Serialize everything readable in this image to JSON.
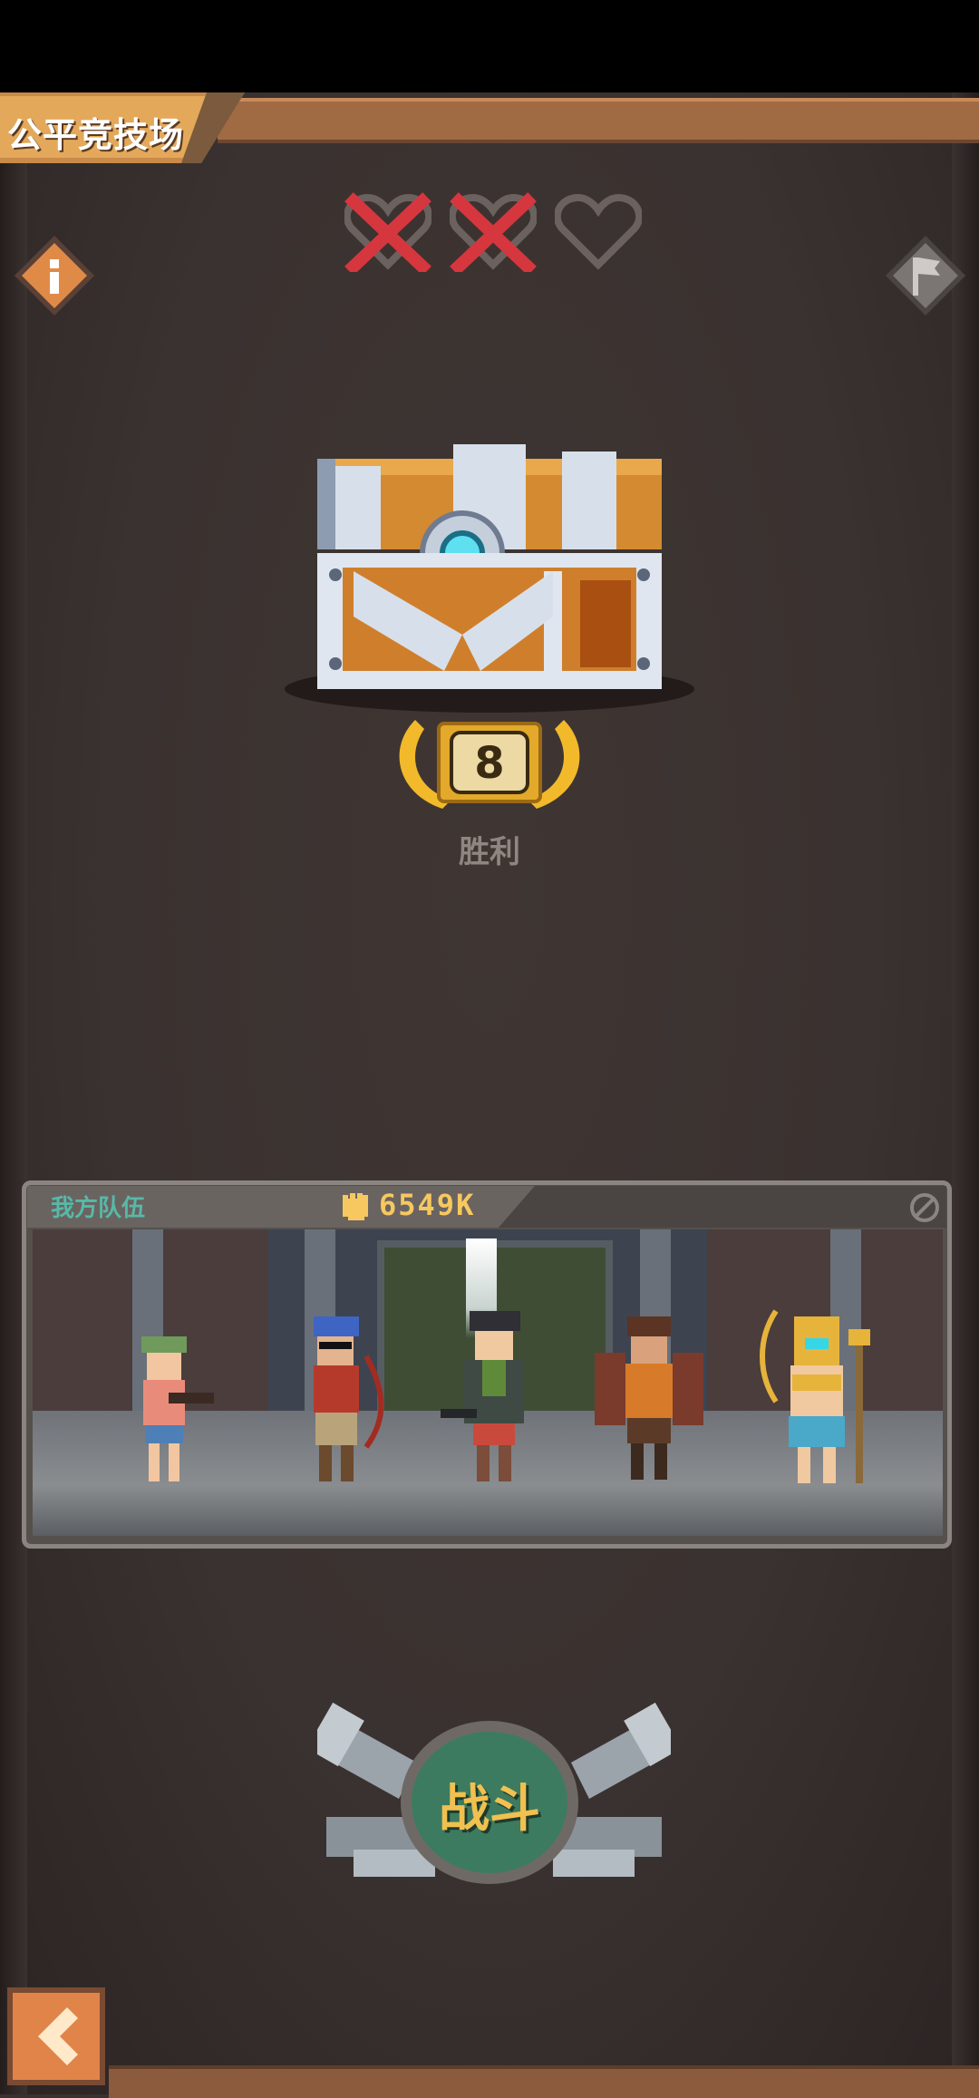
{
  "header": {
    "title": "公平竞技场"
  },
  "lives": {
    "hearts": [
      {
        "state": "lost",
        "icon": "crossed-heart-icon"
      },
      {
        "state": "lost",
        "icon": "crossed-heart-icon"
      },
      {
        "state": "remaining",
        "icon": "heart-outline-icon"
      }
    ]
  },
  "reward": {
    "wins_count": "8",
    "wins_label": "胜利"
  },
  "team": {
    "label": "我方队伍",
    "power": "6549K",
    "heroes": [
      "hero-rifle-girl",
      "hero-sunglasses-archer",
      "hero-cap-gunner",
      "hero-winged-brawler",
      "hero-golden-mage"
    ]
  },
  "actions": {
    "fight_label": "战斗"
  },
  "colors": {
    "accent_gold": "#f1c04f",
    "team_label": "#57b9a8",
    "fight_button": "#3c7b60",
    "ribbon": "#a06a43"
  }
}
